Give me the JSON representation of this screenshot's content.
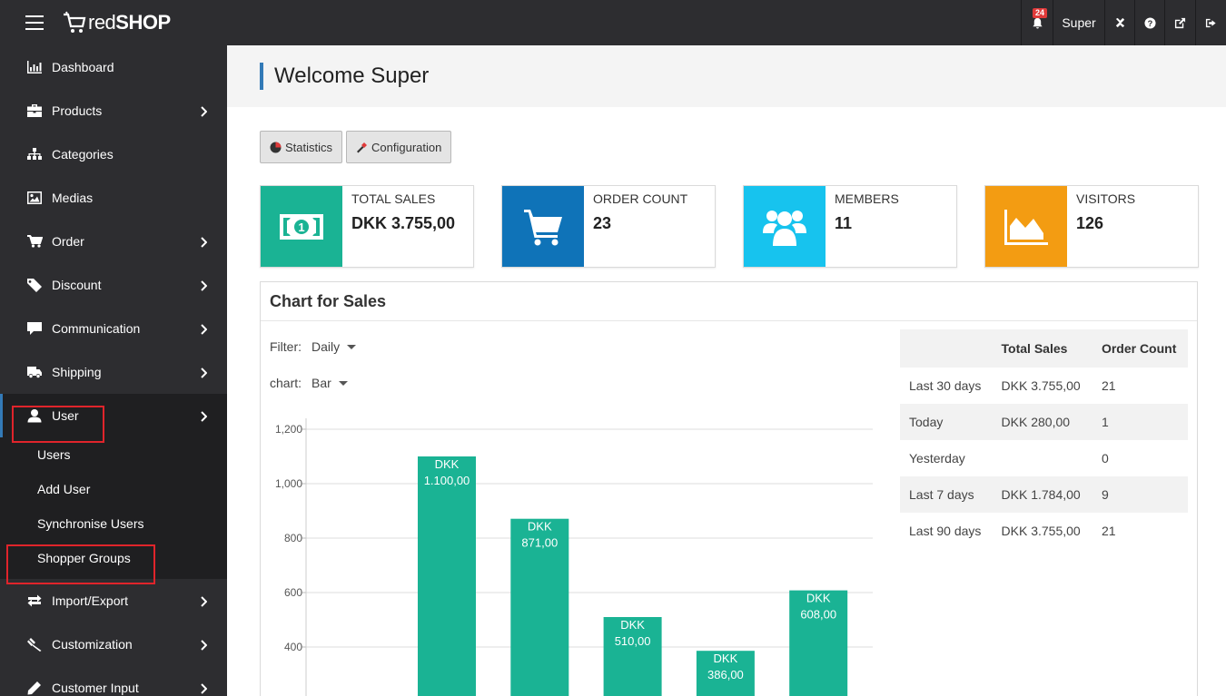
{
  "topbar": {
    "brand": "redSHOP",
    "notification_count": "24",
    "user_name": "Super",
    "icons": [
      "bell-icon",
      "joomla-icon",
      "help-icon",
      "external-link-icon",
      "logout-icon"
    ]
  },
  "sidebar": {
    "items": [
      {
        "label": "Dashboard",
        "icon": "bar-chart-icon",
        "has_children": false
      },
      {
        "label": "Products",
        "icon": "briefcase-icon",
        "has_children": true
      },
      {
        "label": "Categories",
        "icon": "sitemap-icon",
        "has_children": false
      },
      {
        "label": "Medias",
        "icon": "image-icon",
        "has_children": false
      },
      {
        "label": "Order",
        "icon": "cart-icon",
        "has_children": true
      },
      {
        "label": "Discount",
        "icon": "tag-icon",
        "has_children": true
      },
      {
        "label": "Communication",
        "icon": "comment-icon",
        "has_children": true
      },
      {
        "label": "Shipping",
        "icon": "truck-icon",
        "has_children": true
      },
      {
        "label": "User",
        "icon": "user-icon",
        "has_children": true
      },
      {
        "label": "Import/Export",
        "icon": "exchange-icon",
        "has_children": true
      },
      {
        "label": "Customization",
        "icon": "gavel-icon",
        "has_children": true
      },
      {
        "label": "Customer Input",
        "icon": "pencil-icon",
        "has_children": true
      }
    ],
    "user_submenu": [
      "Users",
      "Add User",
      "Synchronise Users",
      "Shopper Groups"
    ]
  },
  "main": {
    "welcome": "Welcome Super",
    "buttons": {
      "statistics": "Statistics",
      "configuration": "Configuration"
    },
    "cards": [
      {
        "label": "TOTAL SALES",
        "value": "DKK 3.755,00",
        "color": "#1ab394",
        "icon": "money-icon"
      },
      {
        "label": "ORDER COUNT",
        "value": "23",
        "color": "#0f73b8",
        "icon": "cart-icon"
      },
      {
        "label": "MEMBERS",
        "value": "11",
        "color": "#17c3ee",
        "icon": "users-icon"
      },
      {
        "label": "VISITORS",
        "value": "126",
        "color": "#f39c12",
        "icon": "area-chart-icon"
      }
    ],
    "panel": {
      "title": "Chart for Sales",
      "filter_label": "Filter:",
      "filter_value": "Daily",
      "chart_label": "chart:",
      "chart_value": "Bar"
    },
    "table": {
      "headers": [
        "",
        "Total Sales",
        "Order Count"
      ],
      "rows": [
        [
          "Last 30 days",
          "DKK 3.755,00",
          "21"
        ],
        [
          "Today",
          "DKK 280,00",
          "1"
        ],
        [
          "Yesterday",
          "",
          "0"
        ],
        [
          "Last 7 days",
          "DKK 1.784,00",
          "9"
        ],
        [
          "Last 90 days",
          "DKK 3.755,00",
          "21"
        ]
      ]
    }
  },
  "chart_data": {
    "type": "bar",
    "values": [
      1100,
      871,
      510,
      386,
      608
    ],
    "value_labels": [
      [
        "DKK",
        "1.100,00"
      ],
      [
        "DKK",
        "871,00"
      ],
      [
        "DKK",
        "510,00"
      ],
      [
        "DKK",
        "386,00"
      ],
      [
        "DKK",
        "608,00"
      ]
    ],
    "yticks": [
      400,
      600,
      800,
      1000,
      1200
    ],
    "ytick_labels": [
      "400",
      "600",
      "800",
      "1,000",
      "1,200"
    ],
    "ylim": [
      0,
      1200
    ],
    "color": "#1ab394",
    "grid": true
  }
}
